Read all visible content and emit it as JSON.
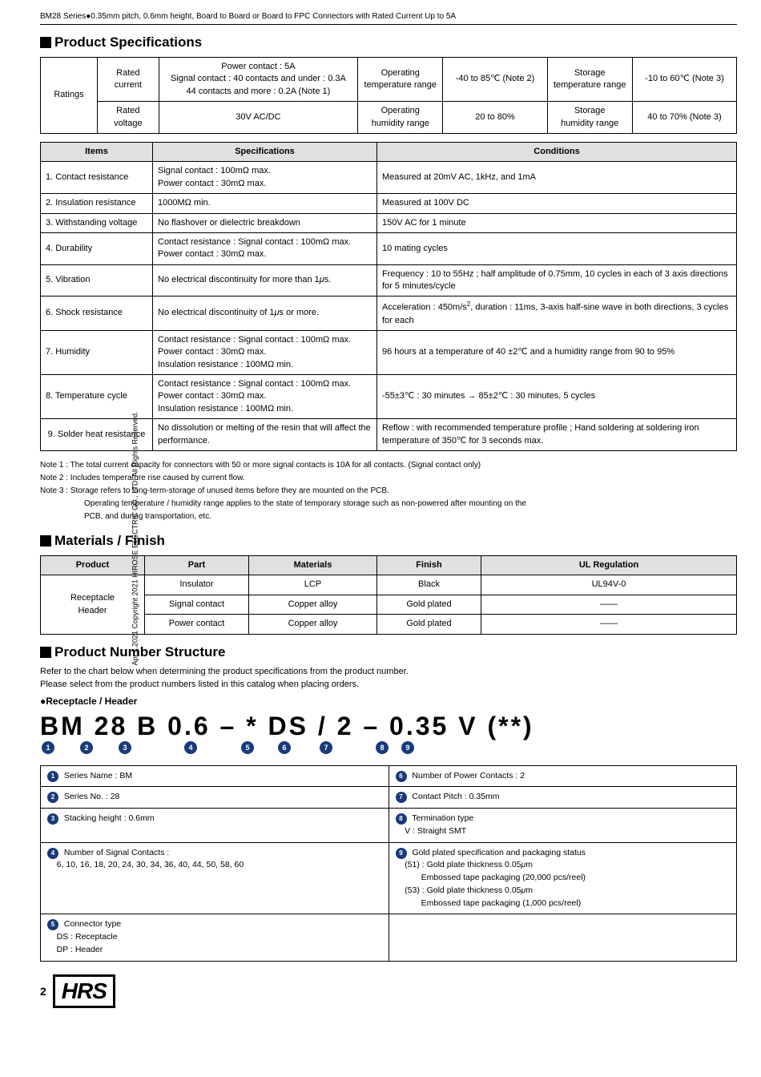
{
  "header": {
    "title": "BM28 Series●0.35mm pitch, 0.6mm height, Board to Board or Board to FPC Connectors with Rated Current Up to 5A"
  },
  "sidebar": {
    "text": "Apr.1.2021 Copyright 2021 HIROSE ELECTRIC CO., LTD. All Rights Reserved."
  },
  "product_specs": {
    "section_title": "Product Specifications",
    "ratings_table": {
      "rows": [
        {
          "label": "Rated current",
          "power_contact": "Power contact : 5A",
          "signal_contact": "Signal contact : 40 contacts and under : 0.3A",
          "signal_contact2": "44 contacts and more  : 0.2A (Note 1)",
          "op_temp_label": "Operating temperature range",
          "op_temp_val": "-40 to 85℃ (Note 2)",
          "storage_temp_label": "Storage temperature range",
          "storage_temp_val": "-10 to 60℃ (Note 3)"
        },
        {
          "label": "Rated voltage",
          "voltage": "30V AC/DC",
          "op_hum_label": "Operating humidity range",
          "op_hum_val": "20 to 80%",
          "storage_hum_label": "Storage humidity range",
          "storage_hum_val": "40 to 70% (Note 3)"
        }
      ]
    },
    "specs_table": {
      "headers": [
        "Items",
        "Specifications",
        "Conditions"
      ],
      "rows": [
        {
          "item": "1. Contact resistance",
          "spec": "Signal contact : 100mΩ max.\nPower contact : 30mΩ max.",
          "condition": "Measured at 20mV AC, 1kHz, and 1mA"
        },
        {
          "item": "2. Insulation resistance",
          "spec": "1000MΩ min.",
          "condition": "Measured at 100V DC"
        },
        {
          "item": "3. Withstanding voltage",
          "spec": "No flashover or dielectric breakdown",
          "condition": "150V AC for 1 minute"
        },
        {
          "item": "4. Durability",
          "spec": "Contact resistance : Signal contact : 100mΩ max.\nPower contact : 30mΩ max.",
          "condition": "10 mating cycles"
        },
        {
          "item": "5. Vibration",
          "spec": "No electrical discontinuity for more than 1μs.",
          "condition": "Frequency : 10 to 55Hz ; half amplitude of 0.75mm, 10 cycles in each of 3 axis directions for 5 minutes/cycle"
        },
        {
          "item": "6. Shock resistance",
          "spec": "No electrical discontinuity of 1μs or more.",
          "condition": "Acceleration : 450m/s², duration : 11ms, 3-axis half-sine wave in both directions, 3 cycles for each"
        },
        {
          "item": "7. Humidity",
          "spec": "Contact resistance : Signal contact : 100mΩ max.\nPower contact : 30mΩ max.\nInsulation resistance : 100MΩ min.",
          "condition": "96 hours at a temperature of 40 ±2℃ and a humidity range from 90 to 95%"
        },
        {
          "item": "8. Temperature cycle",
          "spec": "Contact resistance : Signal contact : 100mΩ max.\nPower contact : 30mΩ max.\nInsulation resistance : 100MΩ min.",
          "condition": "-55±3℃ : 30 minutes → 85±2℃ : 30 minutes, 5 cycles"
        },
        {
          "item": "9. Solder heat resistance",
          "spec": "No dissolution or melting of the resin that will affect the performance.",
          "condition": "Reflow : with recommended temperature profile ; Hand soldering at soldering iron temperature of 350℃ for 3 seconds max."
        }
      ]
    },
    "notes": [
      "Note 1 : The total current capacity for connectors with 50 or more signal contacts is 10A for all contacts. (Signal contact only)",
      "Note 2 : Includes temperature rise caused by current flow.",
      "Note 3 : Storage refers to long-term-storage of unused items before they are mounted on the PCB.",
      "          Operating temperature / humidity range applies to the state of temporary storage such as non-powered after mounting on the",
      "          PCB, and during transportation, etc."
    ]
  },
  "materials": {
    "section_title": "Materials / Finish",
    "table": {
      "headers": [
        "Product",
        "Part",
        "Materials",
        "Finish",
        "UL Regulation"
      ],
      "rows": [
        {
          "product": "Receptacle\nHeader",
          "part": "Insulator",
          "materials": "LCP",
          "finish": "Black",
          "ul": "UL94V-0"
        },
        {
          "product": "",
          "part": "Signal contact",
          "materials": "Copper alloy",
          "finish": "Gold plated",
          "ul": "——"
        },
        {
          "product": "",
          "part": "Power contact",
          "materials": "Copper alloy",
          "finish": "Gold plated",
          "ul": "——"
        }
      ]
    }
  },
  "product_number": {
    "section_title": "Product Number Structure",
    "intro1": "Refer to the chart below when determining the product specifications from the product number.",
    "intro2": "Please select from the product numbers listed in this catalog when placing orders.",
    "subsection": "●Receptacle / Header",
    "formula": "BM 28 B 0.6 – * DS / 2 – 0.35 V (**)",
    "formula_parts": [
      "BM",
      "28",
      "B",
      "0.6",
      "–",
      "*",
      "DS",
      "/",
      "2",
      "–",
      "0.35",
      "V",
      "(**)"
    ],
    "circle_labels": [
      "❶",
      "❷",
      "❸",
      "❹",
      "❺",
      "❻",
      "❼",
      "❽",
      "❾"
    ],
    "descriptions": [
      {
        "num": "❶",
        "label": "Series Name : BM"
      },
      {
        "num": "❻",
        "label": "Number of Power Contacts : 2"
      },
      {
        "num": "❷",
        "label": "Series No. : 28"
      },
      {
        "num": "❼",
        "label": "Contact Pitch : 0.35mm"
      },
      {
        "num": "❸",
        "label": "Stacking height : 0.6mm"
      },
      {
        "num": "❽",
        "label": "Termination type\nV : Straight SMT"
      },
      {
        "num": "❹",
        "label": "Number of Signal Contacts :\n6, 10, 16, 18, 20, 24, 30, 34, 36, 40, 44, 50, 58, 60"
      },
      {
        "num": "❾",
        "label": "Gold plated specification and packaging status\n(51) : Gold plate thickness 0.05μm\n       Embossed tape packaging (20,000 pcs/reel)\n(53) : Gold plate thickness 0.05μm\n       Embossed tape packaging (1,000 pcs/reel)"
      },
      {
        "num": "❺",
        "label": "Connector type\nDS : Receptacle\nDP : Header"
      }
    ]
  },
  "footer": {
    "page_num": "2",
    "logo": "HRS"
  }
}
